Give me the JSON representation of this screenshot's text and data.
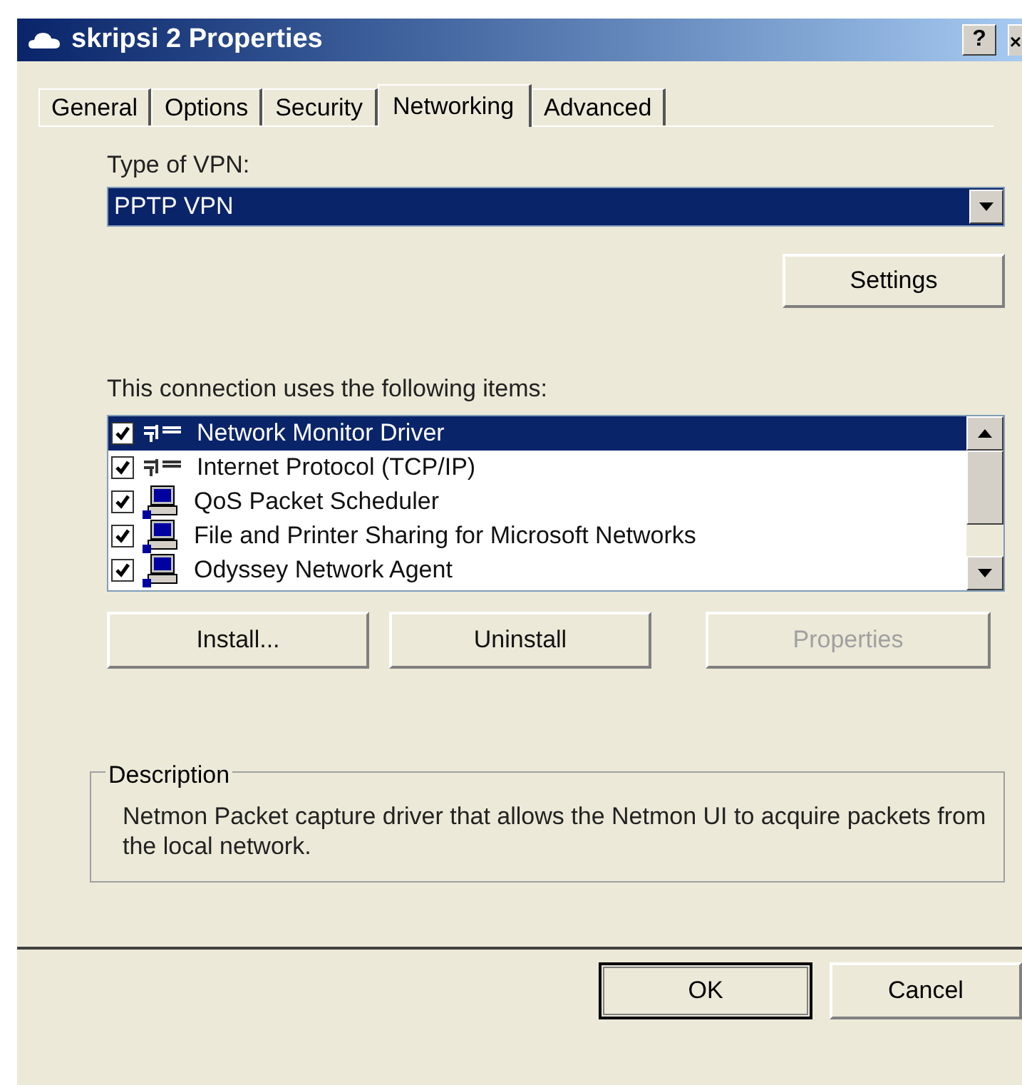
{
  "window": {
    "title": "skripsi 2 Properties",
    "help_button": "?",
    "close_button": "×"
  },
  "tabs": [
    {
      "label": "General",
      "selected": false
    },
    {
      "label": "Options",
      "selected": false
    },
    {
      "label": "Security",
      "selected": false
    },
    {
      "label": "Networking",
      "selected": true
    },
    {
      "label": "Advanced",
      "selected": false
    }
  ],
  "vpn_type": {
    "label": "Type of VPN:",
    "value": "PPTP VPN"
  },
  "settings_button": "Settings",
  "items_label": "This connection uses the following items:",
  "items": [
    {
      "label": "Network Monitor Driver",
      "kind": "protocol",
      "checked": true,
      "selected": true
    },
    {
      "label": "Internet Protocol (TCP/IP)",
      "kind": "protocol",
      "checked": true,
      "selected": false
    },
    {
      "label": "QoS Packet Scheduler",
      "kind": "computer",
      "checked": true,
      "selected": false
    },
    {
      "label": "File and Printer Sharing for Microsoft Networks",
      "kind": "computer",
      "checked": true,
      "selected": false
    },
    {
      "label": "Odyssey Network Agent",
      "kind": "computer",
      "checked": true,
      "selected": false
    }
  ],
  "item_buttons": [
    {
      "label": "Install...",
      "disabled": false
    },
    {
      "label": "Uninstall",
      "disabled": false
    },
    {
      "label": "Properties",
      "disabled": true
    }
  ],
  "description": {
    "title": "Description",
    "text": "Netmon Packet capture driver that allows the Netmon UI to acquire packets from the local network."
  },
  "buttons": [
    {
      "label": "OK",
      "default": true
    },
    {
      "label": "Cancel",
      "default": false
    }
  ]
}
